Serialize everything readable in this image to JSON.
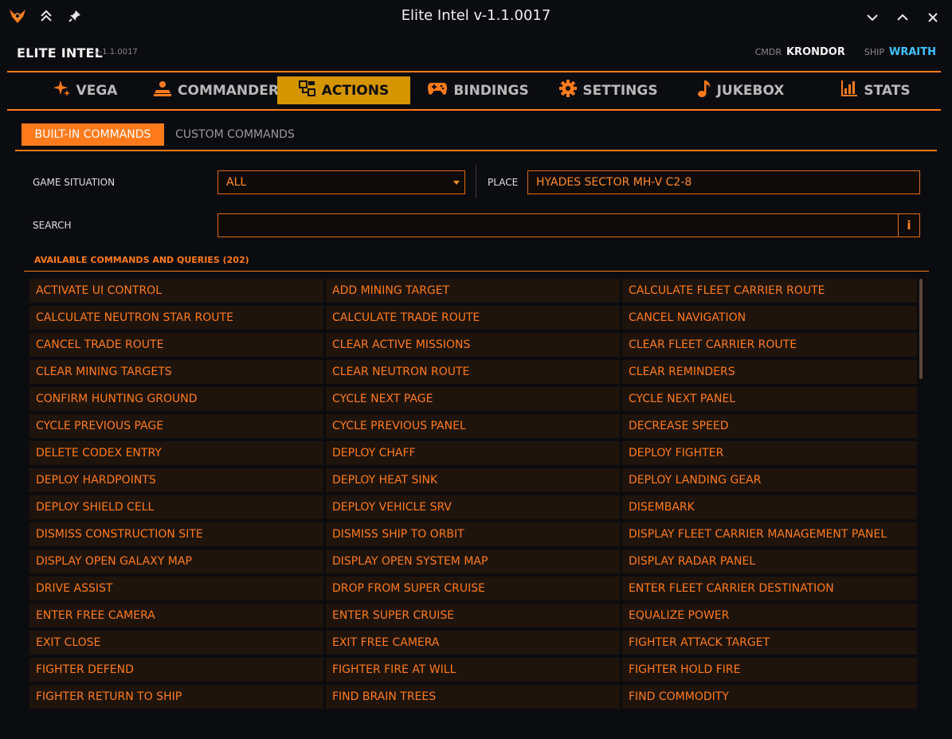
{
  "window": {
    "title": "Elite Intel v-1.1.0017"
  },
  "header": {
    "app_name": "ELITE INTEL",
    "version": "v-1.1.0017",
    "cmdr_label": "CMDR",
    "cmdr_name": "KRONDOR",
    "ship_label": "SHIP",
    "ship_name": "WRAITH"
  },
  "nav": {
    "tabs": [
      {
        "label": "VEGA",
        "icon": "sparkle-icon"
      },
      {
        "label": "COMMANDER",
        "icon": "commander-icon"
      },
      {
        "label": "ACTIONS",
        "icon": "actions-icon",
        "active": true
      },
      {
        "label": "BINDINGS",
        "icon": "gamepad-icon"
      },
      {
        "label": "SETTINGS",
        "icon": "gear-icon"
      },
      {
        "label": "JUKEBOX",
        "icon": "music-note-icon"
      },
      {
        "label": "STATS",
        "icon": "bar-chart-icon"
      }
    ]
  },
  "subtabs": {
    "builtin": "BUILT-IN COMMANDS",
    "custom": "CUSTOM COMMANDS"
  },
  "filters": {
    "situation_label": "GAME SITUATION",
    "situation_value": "ALL",
    "place_label": "PLACE",
    "place_value": "HYADES SECTOR MH-V C2-8",
    "search_label": "SEARCH",
    "search_value": "",
    "info_label": "i"
  },
  "commands": {
    "title": "AVAILABLE COMMANDS AND QUERIES (202)",
    "items": [
      "ACTIVATE UI CONTROL",
      "ADD MINING TARGET",
      "CALCULATE FLEET CARRIER ROUTE",
      "CALCULATE NEUTRON STAR ROUTE",
      "CALCULATE TRADE ROUTE",
      "CANCEL NAVIGATION",
      "CANCEL TRADE ROUTE",
      "CLEAR ACTIVE MISSIONS",
      "CLEAR FLEET CARRIER ROUTE",
      "CLEAR MINING TARGETS",
      "CLEAR NEUTRON ROUTE",
      "CLEAR REMINDERS",
      "CONFIRM HUNTING GROUND",
      "CYCLE NEXT PAGE",
      "CYCLE NEXT PANEL",
      "CYCLE PREVIOUS PAGE",
      "CYCLE PREVIOUS PANEL",
      "DECREASE SPEED",
      "DELETE CODEX ENTRY",
      "DEPLOY CHAFF",
      "DEPLOY FIGHTER",
      "DEPLOY HARDPOINTS",
      "DEPLOY HEAT SINK",
      "DEPLOY LANDING GEAR",
      "DEPLOY SHIELD CELL",
      "DEPLOY VEHICLE SRV",
      "DISEMBARK",
      "DISMISS CONSTRUCTION SITE",
      "DISMISS SHIP TO ORBIT",
      "DISPLAY FLEET CARRIER MANAGEMENT PANEL",
      "DISPLAY OPEN GALAXY MAP",
      "DISPLAY OPEN SYSTEM MAP",
      "DISPLAY RADAR PANEL",
      "DRIVE ASSIST",
      "DROP FROM SUPER CRUISE",
      "ENTER FLEET CARRIER DESTINATION",
      "ENTER FREE CAMERA",
      "ENTER SUPER CRUISE",
      "EQUALIZE POWER",
      "EXIT CLOSE",
      "EXIT FREE CAMERA",
      "FIGHTER ATTACK TARGET",
      "FIGHTER DEFEND",
      "FIGHTER FIRE AT WILL",
      "FIGHTER HOLD FIRE",
      "FIGHTER RETURN TO SHIP",
      "FIND BRAIN TREES",
      "FIND COMMODITY"
    ]
  },
  "colors": {
    "accent": "#ff7a1a",
    "active_tab": "#d49500",
    "ship_name": "#3ec3ff",
    "cell_bg": "#1e140c"
  }
}
